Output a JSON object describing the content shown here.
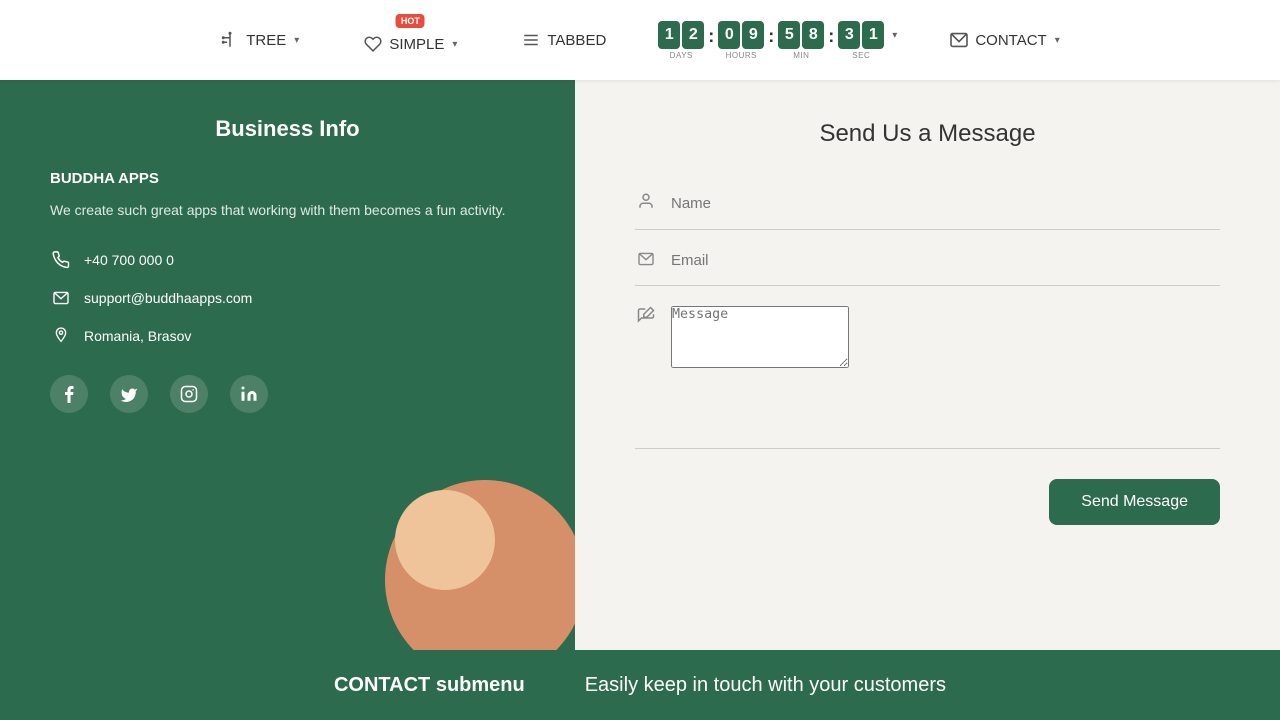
{
  "nav": {
    "items": [
      {
        "id": "tree",
        "label": "TREE",
        "icon": "⊞",
        "has_chevron": true,
        "hot": false
      },
      {
        "id": "simple",
        "label": "SIMPLE",
        "icon": "♡",
        "has_chevron": true,
        "hot": true
      },
      {
        "id": "tabbed",
        "label": "TABBED",
        "icon": "≡",
        "has_chevron": false,
        "hot": false
      },
      {
        "id": "contact",
        "label": "CONTACT",
        "icon": "✉",
        "has_chevron": true,
        "hot": false
      }
    ],
    "hot_label": "HOT",
    "countdown": {
      "days": [
        "1",
        "2"
      ],
      "hours": [
        "0",
        "9"
      ],
      "minutes": [
        "5",
        "8"
      ],
      "seconds": [
        "3",
        "1"
      ],
      "labels": [
        "DAYS",
        "HOURS",
        "MIN",
        "SEC"
      ]
    }
  },
  "left_panel": {
    "title": "Business Info",
    "company_name": "BUDDHA APPS",
    "description": "We create such great apps that working with them becomes a fun activity.",
    "phone": "+40 700 000 0",
    "email": "support@buddhaapps.com",
    "address": "Romania, Brasov",
    "social": [
      "f",
      "t",
      "ig",
      "in"
    ]
  },
  "right_panel": {
    "title": "Send Us a Message",
    "name_placeholder": "Name",
    "email_placeholder": "Email",
    "message_placeholder": "Message",
    "send_button": "Send Message"
  },
  "bottom_bar": {
    "left": "CONTACT submenu",
    "right": "Easily keep in touch with your customers"
  }
}
